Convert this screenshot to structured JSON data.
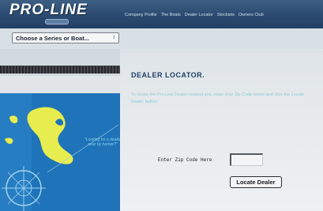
{
  "header": {
    "logo_text": "PRO-LINE",
    "logo_badge": "",
    "nav": [
      "Company Profile",
      "The Boats",
      "Dealer Locator",
      "Stockists",
      "Owners Club"
    ]
  },
  "series_select": {
    "selected": "Choose a Series or Boat...",
    "arrow": "↕"
  },
  "sidebar": {
    "quote": "\"Looking for a dealer near by harbor?\""
  },
  "main": {
    "title": "DEALER LOCATOR.",
    "intro": "To locate the Pro-Line Dealer nearest you, enter your Zip Code below and click the Locate Dealer button.",
    "zip_label": "Enter Zip Code Here",
    "zip_value": "",
    "button_label": "Locate Dealer"
  },
  "colors": {
    "header_bg": "#2b4a70",
    "title": "#1f3f66",
    "intro_text": "#8fcbd9",
    "nav_text": "#c7e3e8"
  }
}
